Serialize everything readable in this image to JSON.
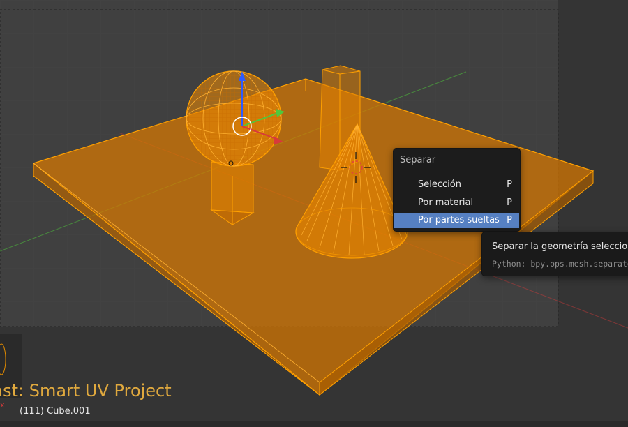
{
  "menu": {
    "title": "Separar",
    "items": [
      {
        "label": "Selección",
        "shortcut": "P",
        "highlighted": false
      },
      {
        "label": "Por material",
        "shortcut": "P",
        "highlighted": false
      },
      {
        "label": "Por partes sueltas",
        "shortcut": "P",
        "highlighted": true
      }
    ]
  },
  "tooltip": {
    "description": "Separar la geometría seleccionada",
    "python": "Python: bpy.ops.mesh.separate"
  },
  "status": {
    "last_operator": "Last: Smart UV Project",
    "object_info": "(111) Cube.001",
    "axis_x": "x"
  },
  "colors": {
    "selection_orange": "#ffa000",
    "menu_highlight": "#5680c2",
    "operator_text": "#e0a93e",
    "axis_x": "#d83a3a",
    "axis_y": "#4fc83c",
    "axis_z": "#2d5bff"
  },
  "icons": [
    "manipulator-widget",
    "3d-cursor-icon",
    "camera-preview-icon"
  ]
}
